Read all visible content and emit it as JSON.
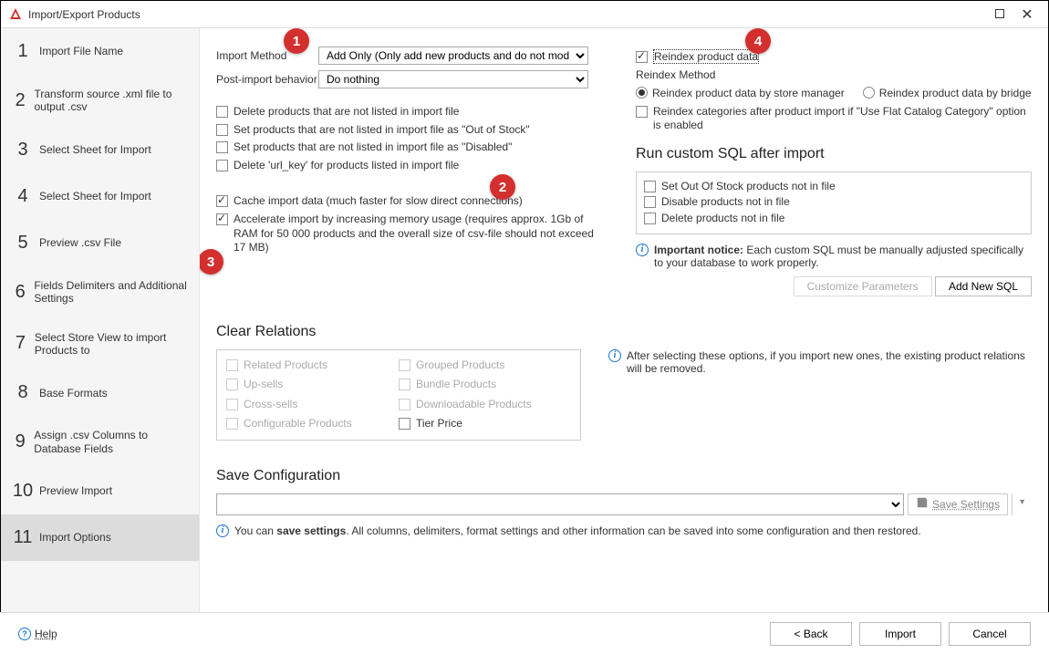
{
  "window": {
    "title": "Import/Export Products"
  },
  "steps": [
    {
      "n": "1",
      "label": "Import File Name"
    },
    {
      "n": "2",
      "label": "Transform source .xml file to output .csv"
    },
    {
      "n": "3",
      "label": "Select Sheet for Import"
    },
    {
      "n": "4",
      "label": "Select Sheet for Import"
    },
    {
      "n": "5",
      "label": "Preview .csv File"
    },
    {
      "n": "6",
      "label": "Fields Delimiters and Additional Settings"
    },
    {
      "n": "7",
      "label": "Select Store View to import Products to"
    },
    {
      "n": "8",
      "label": "Base Formats"
    },
    {
      "n": "9",
      "label": "Assign .csv Columns to Database Fields"
    },
    {
      "n": "10",
      "label": "Preview Import"
    },
    {
      "n": "11",
      "label": "Import Options"
    }
  ],
  "form": {
    "import_method_label": "Import Method",
    "import_method_value": "Add Only (Only add new products and do not modify existing",
    "post_import_label": "Post-import behavior",
    "post_import_value": "Do nothing",
    "cb_delete_unlisted": "Delete products that are not listed in import file",
    "cb_out_of_stock": "Set products that are not listed in import file as \"Out of Stock\"",
    "cb_disabled": "Set products that are not listed in import file as \"Disabled\"",
    "cb_delete_urlkey": "Delete 'url_key' for products listed in import file",
    "cb_cache": "Cache import data (much faster for slow direct connections)",
    "cb_accel": "Accelerate import by increasing memory usage (requires approx. 1Gb of RAM for 50 000 products and the overall size of csv-file should not exceed 17 MB)"
  },
  "reindex": {
    "cb_label": "Reindex product data",
    "method_label": "Reindex Method",
    "opt1": "Reindex product data by store manager",
    "opt2": "Reindex product data by bridge",
    "cb_categories": "Reindex categories after product import if \"Use Flat Catalog Category\" option is enabled"
  },
  "sql": {
    "heading": "Run custom SQL after import",
    "cb1": "Set Out Of Stock products not in file",
    "cb2": "Disable products not in file",
    "cb3": "Delete products not in file",
    "notice_bold": "Important notice:",
    "notice_rest": " Each custom SQL must be manually adjusted specifically to your database to work properly.",
    "btn_customize": "Customize Parameters",
    "btn_add": "Add New SQL"
  },
  "clear": {
    "heading": "Clear Relations",
    "related": "Related Products",
    "upsells": "Up-sells",
    "cross": "Cross-sells",
    "config": "Configurable Products",
    "grouped": "Grouped Products",
    "bundle": "Bundle Products",
    "download": "Downloadable Products",
    "tier": "Tier Price",
    "info": "After selecting these options, if you import new ones, the existing product relations will be removed."
  },
  "save": {
    "heading": "Save Configuration",
    "btn": "Save Settings",
    "info_pre": "You can ",
    "info_bold": "save settings",
    "info_post": ". All columns, delimiters, format settings and other information can be saved into some configuration and then restored."
  },
  "footer": {
    "help": "Help",
    "back": "< Back",
    "import": "Import",
    "cancel": "Cancel"
  },
  "callouts": {
    "c1": "1",
    "c2": "2",
    "c3": "3",
    "c4": "4"
  }
}
